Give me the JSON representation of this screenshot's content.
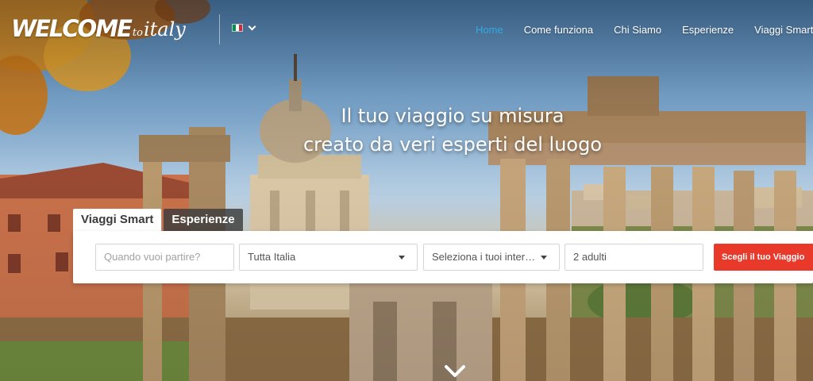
{
  "logo": {
    "main": "WELCOME",
    "to": "to",
    "italy": "italy"
  },
  "language": {
    "flag": "italian-flag-icon",
    "colors": [
      "#009246",
      "#ffffff",
      "#ce2b37"
    ]
  },
  "nav": {
    "items": [
      {
        "label": "Home",
        "active": true
      },
      {
        "label": "Come funziona"
      },
      {
        "label": "Chi Siamo"
      },
      {
        "label": "Esperienze"
      },
      {
        "label": "Viaggi Smart"
      }
    ],
    "active_color": "#35a8e0"
  },
  "hero": {
    "line1": "Il tuo viaggio su misura",
    "line2": "creato da veri esperti del luogo"
  },
  "search": {
    "tabs": [
      {
        "label": "Viaggi Smart",
        "active": true
      },
      {
        "label": "Esperienze"
      }
    ],
    "date": {
      "placeholder": "Quando vuoi partire?"
    },
    "region": {
      "value": "Tutta Italia"
    },
    "interests": {
      "value": "Seleziona i tuoi inter…"
    },
    "guests": {
      "value": "2 adulti"
    },
    "submit": "Scegli il tuo Viaggio",
    "submit_color": "#e8392a"
  }
}
